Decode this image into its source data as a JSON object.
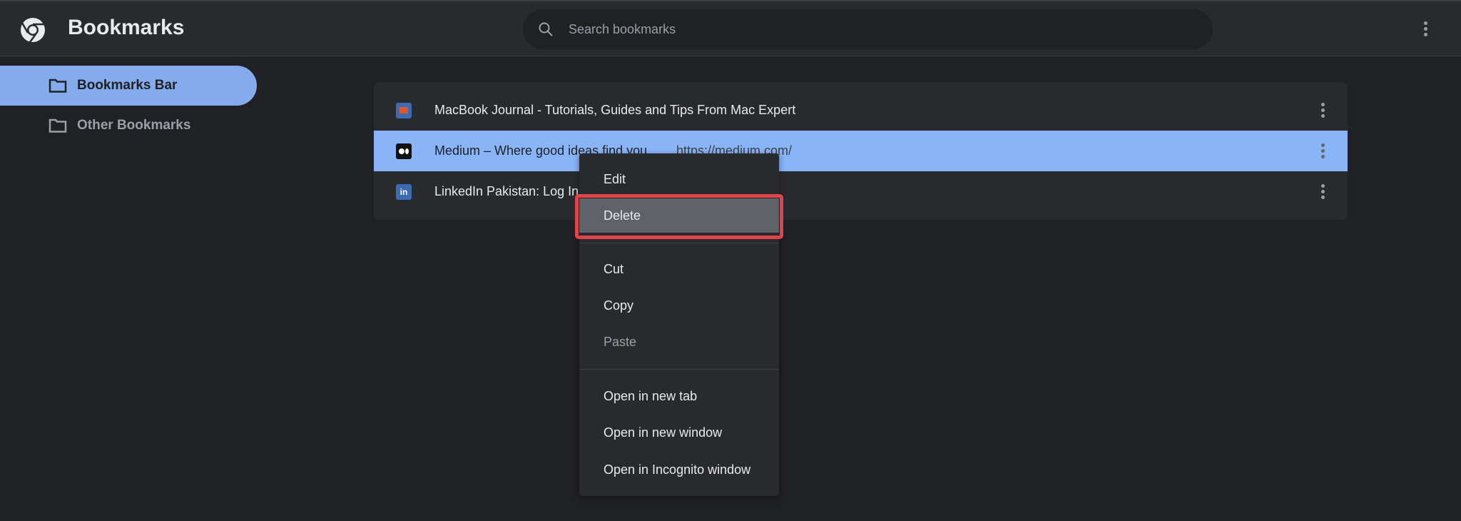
{
  "header": {
    "title": "Bookmarks",
    "search_placeholder": "Search bookmarks"
  },
  "sidebar": {
    "items": [
      {
        "label": "Bookmarks Bar",
        "selected": true
      },
      {
        "label": "Other Bookmarks",
        "selected": false
      }
    ]
  },
  "bookmarks": [
    {
      "title": "MacBook Journal - Tutorials, Guides and Tips From Mac Expert",
      "url": "",
      "icon": "macbook-journal-favicon"
    },
    {
      "title": "Medium – Where good ideas find you.",
      "url": "https://medium.com/",
      "icon": "medium-favicon",
      "selected": true
    },
    {
      "title": "LinkedIn Pakistan: Log In or Sign Up",
      "url": "",
      "icon": "linkedin-favicon",
      "favicon_text": "in"
    }
  ],
  "context_menu": {
    "items": [
      "Edit",
      "Delete",
      "Cut",
      "Copy",
      "Paste",
      "Open in new tab",
      "Open in new window",
      "Open in Incognito window"
    ],
    "highlighted": "Delete",
    "disabled": [
      "Paste"
    ]
  },
  "colors": {
    "accent": "#8ab4f8",
    "highlight_border": "#e0444a"
  }
}
